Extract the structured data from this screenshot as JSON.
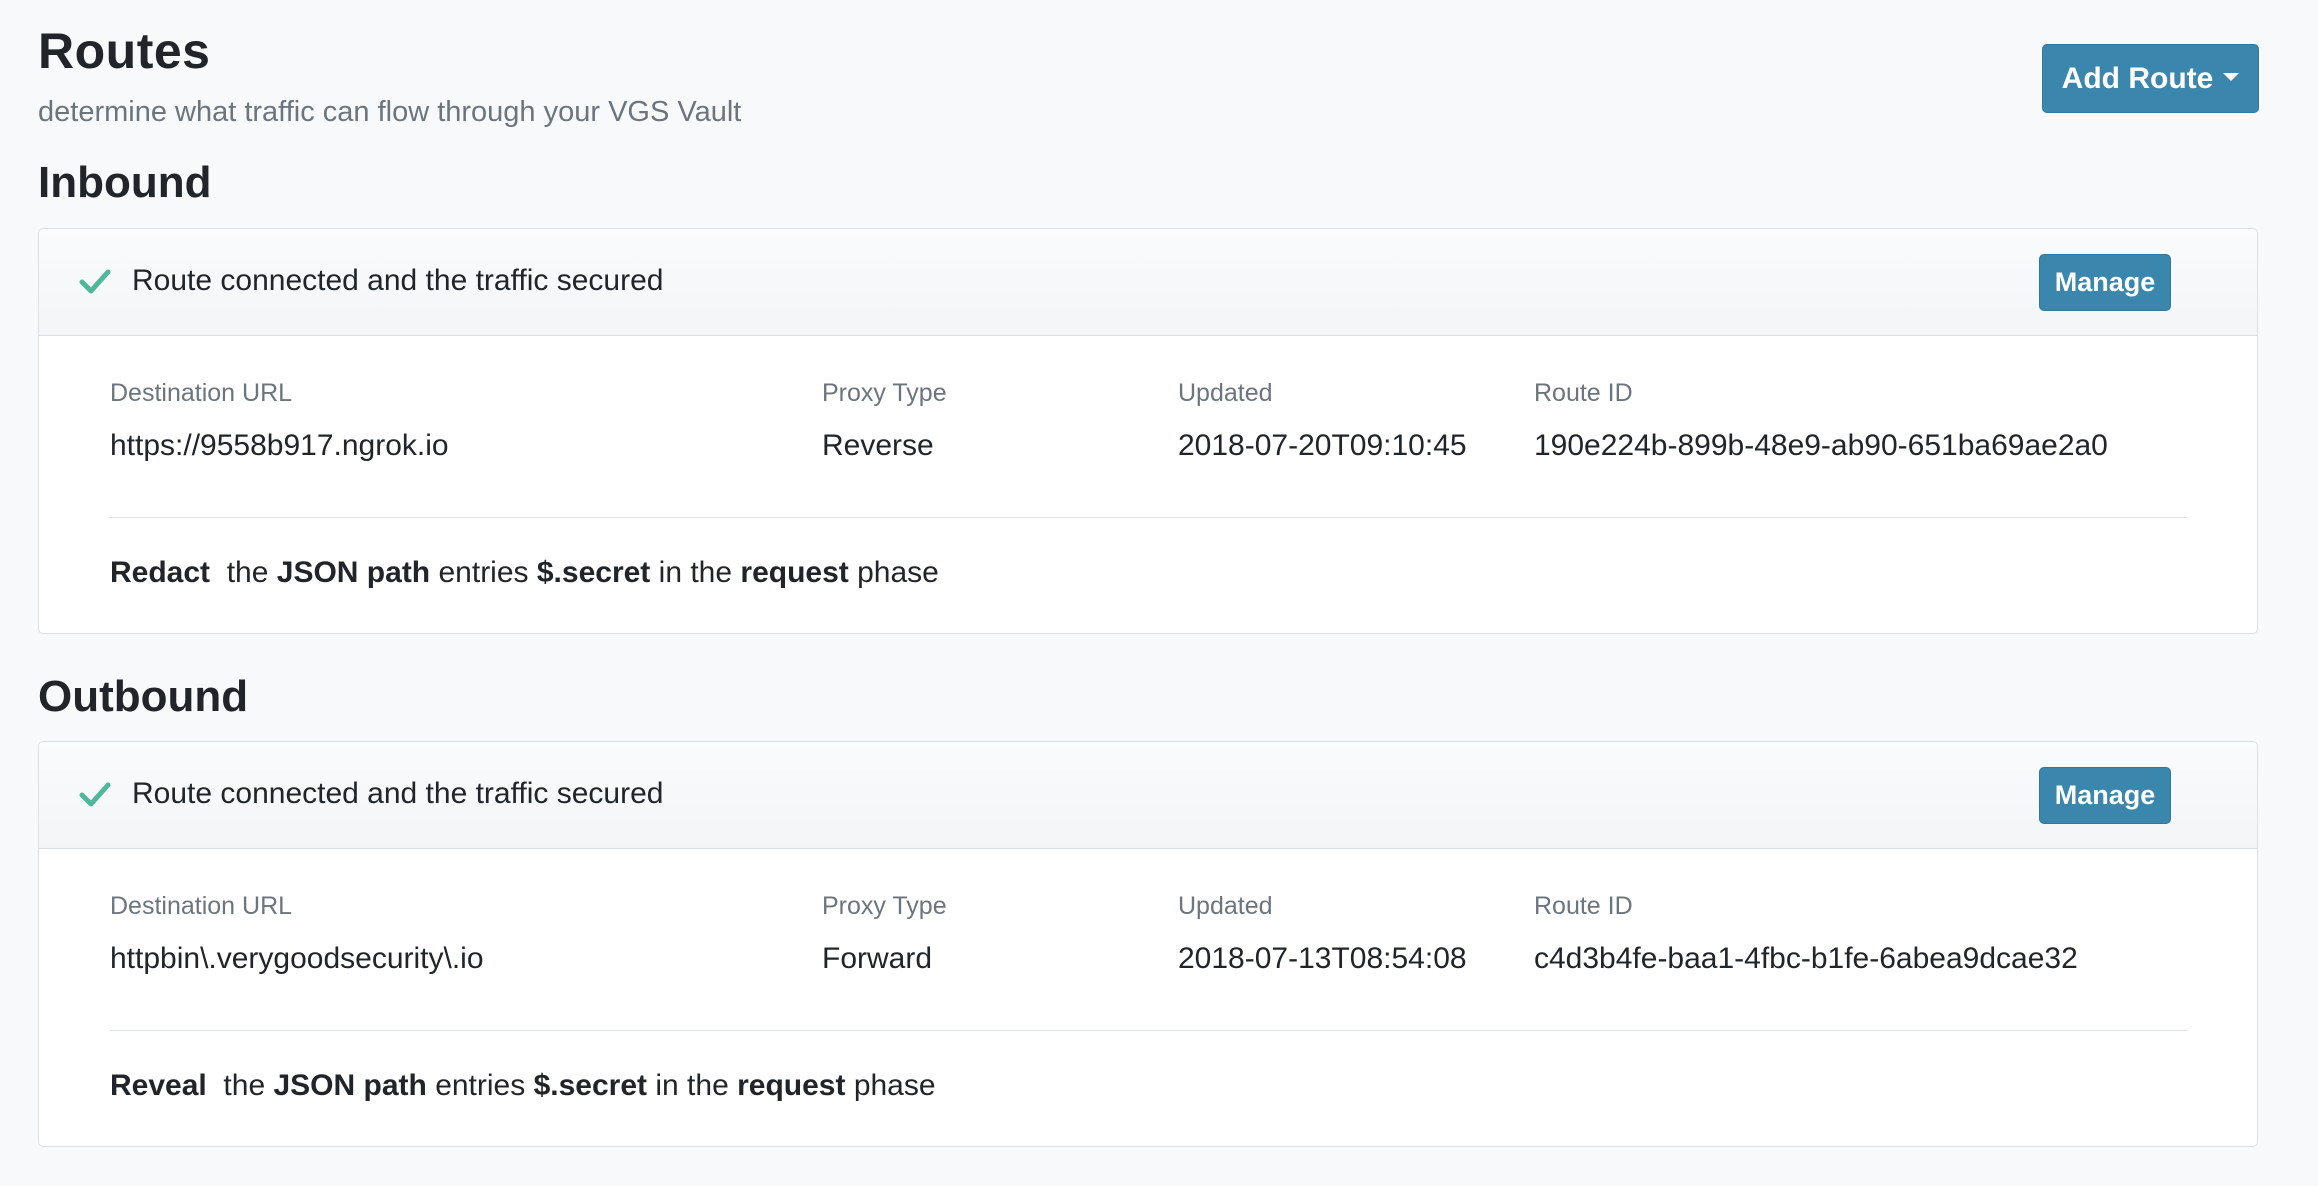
{
  "header": {
    "title": "Routes",
    "subtitle": "determine what traffic can flow through your VGS Vault",
    "add_route_label": "Add Route"
  },
  "routes": [
    {
      "section_title": "Inbound",
      "status": "Route connected and the traffic secured",
      "manage_label": "Manage",
      "fields": {
        "destination_url_label": "Destination URL",
        "destination_url": "https://9558b917.ngrok.io",
        "proxy_type_label": "Proxy Type",
        "proxy_type": "Reverse",
        "updated_label": "Updated",
        "updated": "2018-07-20T09:10:45",
        "route_id_label": "Route ID",
        "route_id": "190e224b-899b-48e9-ab90-651ba69ae2a0"
      },
      "rule": {
        "operation": "Redact",
        "the": "the",
        "target": "JSON path",
        "entries": "entries",
        "path": "$.secret",
        "in_the": "in the",
        "phase_name": "request",
        "phase": "phase"
      }
    },
    {
      "section_title": "Outbound",
      "status": "Route connected and the traffic secured",
      "manage_label": "Manage",
      "fields": {
        "destination_url_label": "Destination URL",
        "destination_url": "httpbin\\.verygoodsecurity\\.io",
        "proxy_type_label": "Proxy Type",
        "proxy_type": "Forward",
        "updated_label": "Updated",
        "updated": "2018-07-13T08:54:08",
        "route_id_label": "Route ID",
        "route_id": "c4d3b4fe-baa1-4fbc-b1fe-6abea9dcae32"
      },
      "rule": {
        "operation": "Reveal",
        "the": "the",
        "target": "JSON path",
        "entries": "entries",
        "path": "$.secret",
        "in_the": "in the",
        "phase_name": "request",
        "phase": "phase"
      }
    }
  ],
  "icons": {
    "status": "check-icon"
  },
  "colors": {
    "primary_button": "#3a86ad",
    "success_check": "#4fb89a",
    "page_background": "#f8f9fa"
  }
}
